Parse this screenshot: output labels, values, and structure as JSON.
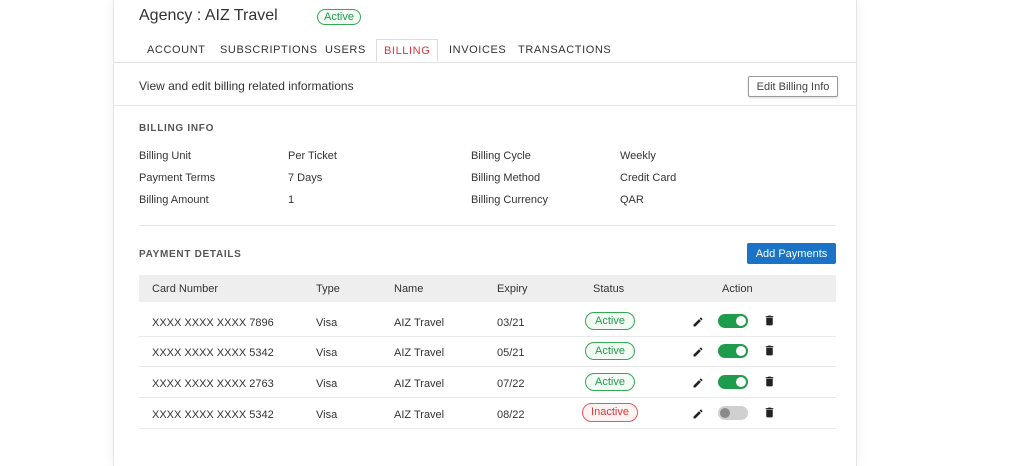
{
  "agency": {
    "title": "Agency : AIZ Travel",
    "status": "Active"
  },
  "tabs": [
    {
      "label": "ACCOUNT"
    },
    {
      "label": "SUBSCRIPTIONS"
    },
    {
      "label": "USERS"
    },
    {
      "label": "BILLING",
      "active": true
    },
    {
      "label": "INVOICES"
    },
    {
      "label": "TRANSACTIONS"
    }
  ],
  "billing_header": {
    "description": "View and edit billing related informations",
    "edit_button": "Edit Billing Info"
  },
  "billing_info": {
    "section_title": "BILLING INFO",
    "fields": [
      {
        "label": "Billing Unit",
        "value": "Per Ticket"
      },
      {
        "label": "Payment Terms",
        "value": "7 Days"
      },
      {
        "label": "Billing Amount",
        "value": "1"
      },
      {
        "label": "Billing Cycle",
        "value": "Weekly"
      },
      {
        "label": "Billing Method",
        "value": "Credit Card"
      },
      {
        "label": "Billing Currency",
        "value": "QAR"
      }
    ]
  },
  "payment_details": {
    "section_title": "PAYMENT DETAILS",
    "add_button": "Add Payments",
    "columns": [
      "Card Number",
      "Type",
      "Name",
      "Expiry",
      "Status",
      "Action"
    ],
    "rows": [
      {
        "card": "XXXX XXXX XXXX 7896",
        "type": "Visa",
        "name": "AIZ Travel",
        "expiry": "03/21",
        "status": "Active",
        "enabled": true
      },
      {
        "card": "XXXX XXXX XXXX 5342",
        "type": "Visa",
        "name": "AIZ Travel",
        "expiry": "05/21",
        "status": "Active",
        "enabled": true
      },
      {
        "card": "XXXX XXXX XXXX 2763",
        "type": "Visa",
        "name": "AIZ Travel",
        "expiry": "07/22",
        "status": "Active",
        "enabled": true
      },
      {
        "card": "XXXX XXXX XXXX 5342",
        "type": "Visa",
        "name": "AIZ Travel",
        "expiry": "08/22",
        "status": "Inactive",
        "enabled": false
      }
    ],
    "action_icons": [
      "pencil-icon",
      "toggle-switch",
      "trash-icon"
    ]
  },
  "colors": {
    "accent": "#d9363e",
    "active": "#1e9c4c",
    "inactive": "#d93a3a",
    "primary_button": "#1a73c6"
  }
}
